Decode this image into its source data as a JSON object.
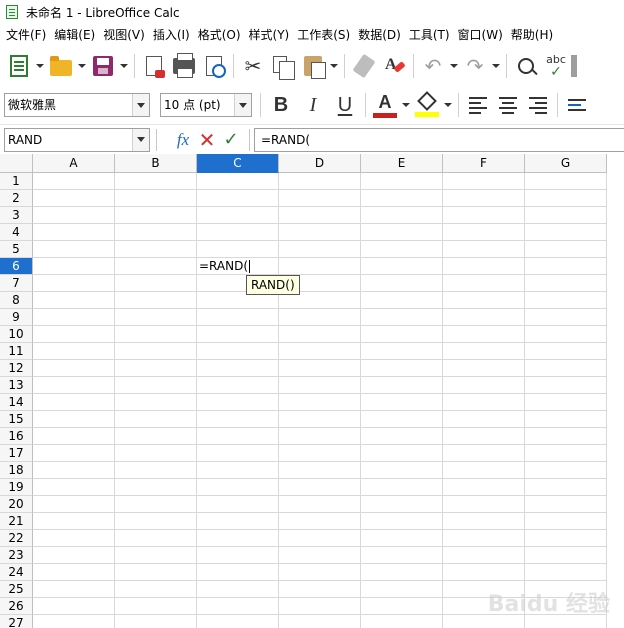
{
  "window": {
    "title": "未命名 1 - LibreOffice Calc"
  },
  "menu": [
    "文件(F)",
    "编辑(E)",
    "视图(V)",
    "插入(I)",
    "格式(O)",
    "样式(Y)",
    "工作表(S)",
    "数据(D)",
    "工具(T)",
    "窗口(W)",
    "帮助(H)"
  ],
  "toolbar": {
    "icons": [
      "new-spreadsheet-icon",
      "open-folder-icon",
      "save-icon",
      "export-pdf-icon",
      "print-icon",
      "print-preview-icon",
      "cut-icon",
      "copy-icon",
      "paste-icon",
      "clone-formatting-icon",
      "clear-formatting-icon",
      "undo-icon",
      "redo-icon",
      "find-replace-icon",
      "spelling-icon"
    ],
    "font_name": "微软雅黑",
    "font_size": "10 点 (pt)",
    "bold_label": "B",
    "italic_label": "I",
    "underline_label": "U",
    "font_color_label": "A",
    "font_color": "#c9211e",
    "highlight_color": "#ffff00",
    "spelling_label": "abc"
  },
  "formula_bar": {
    "name_box": "RAND",
    "fx_label": "fx",
    "cancel_symbol": "✕",
    "accept_symbol": "✓",
    "content": "=RAND("
  },
  "sheet": {
    "columns": [
      "A",
      "B",
      "C",
      "D",
      "E",
      "F",
      "G"
    ],
    "active_column": "C",
    "rows": [
      "1",
      "2",
      "3",
      "4",
      "5",
      "6",
      "7",
      "8",
      "9",
      "10",
      "11",
      "12",
      "13",
      "14",
      "15",
      "16",
      "17",
      "18",
      "19",
      "20",
      "21",
      "22",
      "23",
      "24",
      "25",
      "26",
      "27"
    ],
    "active_row": "6",
    "active_cell_content": "=RAND(",
    "tooltip": "RAND()"
  },
  "watermark": "Baidu 经验",
  "colors": {
    "accent": "#1f6fcf"
  }
}
